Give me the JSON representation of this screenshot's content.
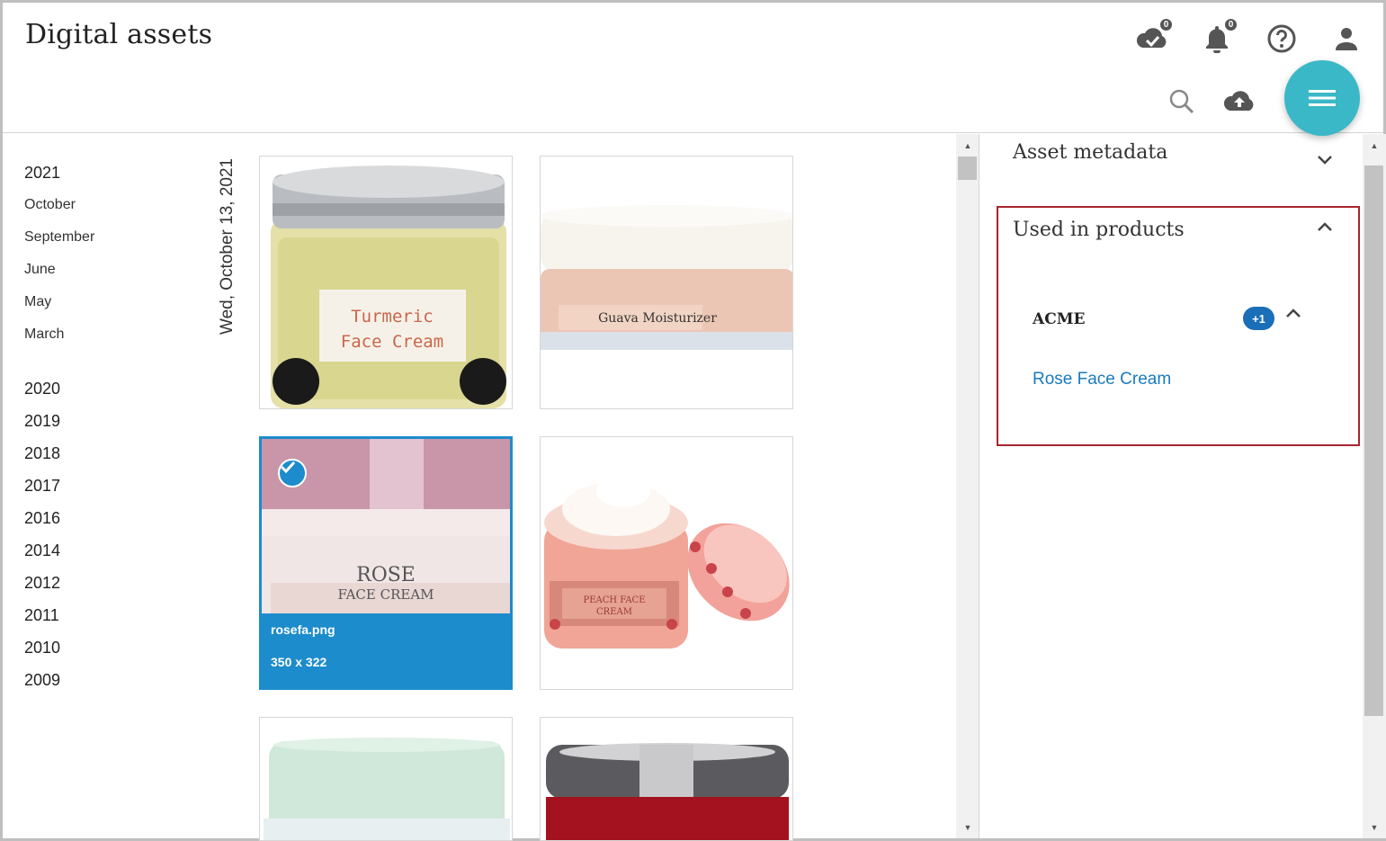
{
  "app": {
    "title": "Digital assets"
  },
  "header": {
    "sync_count": "0",
    "notifications_count": "0"
  },
  "nav": {
    "years": [
      {
        "label": "2021",
        "months": [
          "October",
          "September",
          "June",
          "May",
          "March"
        ]
      },
      {
        "label": "2020"
      },
      {
        "label": "2019"
      },
      {
        "label": "2018"
      },
      {
        "label": "2017"
      },
      {
        "label": "2016"
      },
      {
        "label": "2014"
      },
      {
        "label": "2012"
      },
      {
        "label": "2011"
      },
      {
        "label": "2010"
      },
      {
        "label": "2009"
      }
    ]
  },
  "gallery": {
    "day_label": "Wed, October 13, 2021",
    "assets": [
      {
        "label_line1": "Turmeric",
        "label_line2": "Face Cream"
      },
      {
        "label_line1": "Guava Moisturizer"
      },
      {
        "label_line1": "ROSE",
        "label_line2": "FACE CREAM",
        "filename": "rosefa.png",
        "dimensions": "350 x 322",
        "selected": true
      },
      {
        "label_line1": "PEACH FACE",
        "label_line2": "CREAM"
      },
      {
        "label_line1": ""
      },
      {
        "label_line1": ""
      }
    ]
  },
  "panel": {
    "metadata_title": "Asset metadata",
    "used_title": "Used in products",
    "catalog": "ACME",
    "more_badge": "+1",
    "product": "Rose Face Cream"
  },
  "colors": {
    "accent": "#1d8ccc",
    "fab": "#3ab8c7",
    "highlight_border": "#a8242f",
    "link": "#1a7bbf"
  }
}
